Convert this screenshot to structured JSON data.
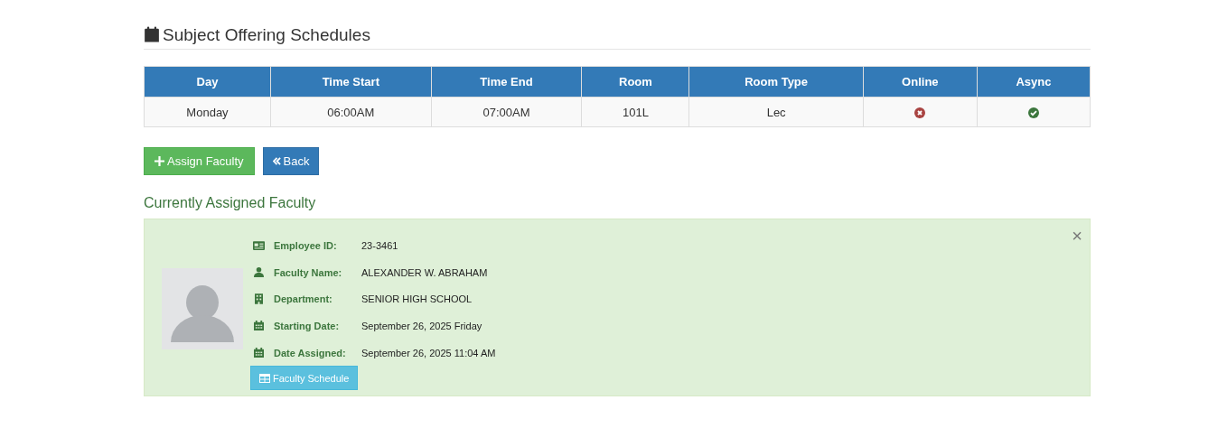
{
  "title": "Subject Offering Schedules",
  "table": {
    "columns": [
      "Day",
      "Time Start",
      "Time End",
      "Room",
      "Room Type",
      "Online",
      "Async"
    ],
    "rows": [
      {
        "day": "Monday",
        "time_start": "06:00AM",
        "time_end": "07:00AM",
        "room": "101L",
        "room_type": "Lec",
        "online": false,
        "async": true
      }
    ]
  },
  "buttons": [
    {
      "kind": "add",
      "label": "Assign Faculty"
    },
    {
      "kind": "back",
      "label": "Back"
    }
  ],
  "assigned": {
    "heading": "Currently Assigned Faculty",
    "close": "×",
    "fields": [
      {
        "kind": "id",
        "label": "Employee ID:",
        "value": "23-3461"
      },
      {
        "kind": "person",
        "label": "Faculty Name:",
        "value": "ALEXANDER W. ABRAHAM"
      },
      {
        "kind": "building",
        "label": "Department:",
        "value": "SENIOR HIGH SCHOOL"
      },
      {
        "kind": "date",
        "label": "Starting Date:",
        "value": "September 26, 2025 Friday"
      },
      {
        "kind": "date",
        "label": "Date Assigned:",
        "value": "September 26, 2025 11:04 AM"
      }
    ],
    "schedule_button": "Faculty Schedule"
  }
}
